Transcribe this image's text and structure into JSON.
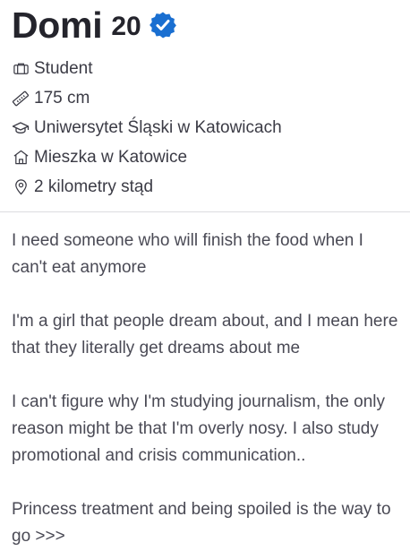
{
  "profile": {
    "name": "Domi",
    "age": "20",
    "verified_icon": "verified-badge-icon",
    "accent_color": "#1a6fd1"
  },
  "details": [
    {
      "icon": "briefcase-icon",
      "text": "Student"
    },
    {
      "icon": "ruler-icon",
      "text": "175 cm"
    },
    {
      "icon": "graduation-cap-icon",
      "text": "Uniwersytet Śląski w Katowicach"
    },
    {
      "icon": "home-icon",
      "text": "Mieszka w Katowice"
    },
    {
      "icon": "location-pin-icon",
      "text": "2 kilometry stąd"
    }
  ],
  "bio": [
    "I need someone who will finish the food when I can't eat anymore",
    "I'm a girl that people dream about, and I mean here that they literally get dreams about me",
    "I can't figure why I'm studying journalism, the only reason might be that I'm overly nosy. I also study promotional and crisis communication..",
    "Princess treatment and being spoiled is the way to go >>>"
  ]
}
